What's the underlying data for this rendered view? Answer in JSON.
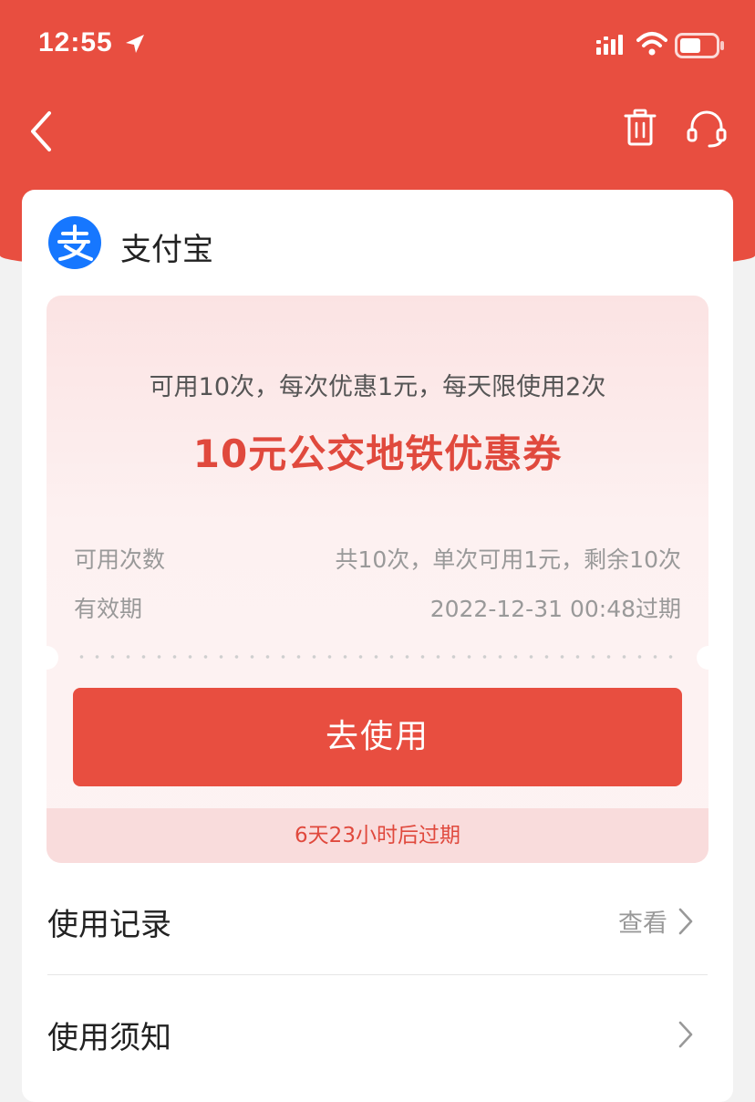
{
  "status_bar": {
    "time": "12:55"
  },
  "merchant": {
    "name": "支付宝"
  },
  "coupon": {
    "subtitle": "可用10次，每次优惠1元，每天限使用2次",
    "title": "10元公交地铁优惠券",
    "info": [
      {
        "label": "可用次数",
        "value": "共10次，单次可用1元，剩余10次"
      },
      {
        "label": "有效期",
        "value": "2022-12-31 00:48过期"
      }
    ],
    "use_button": "去使用",
    "expire_notice": "6天23小时后过期"
  },
  "list": {
    "usage_record": {
      "label": "使用记录",
      "action": "查看"
    },
    "usage_notice": {
      "label": "使用须知"
    }
  },
  "colors": {
    "brand_red": "#e84e40",
    "alipay_blue": "#1677ff",
    "title_red": "#e0493d"
  }
}
